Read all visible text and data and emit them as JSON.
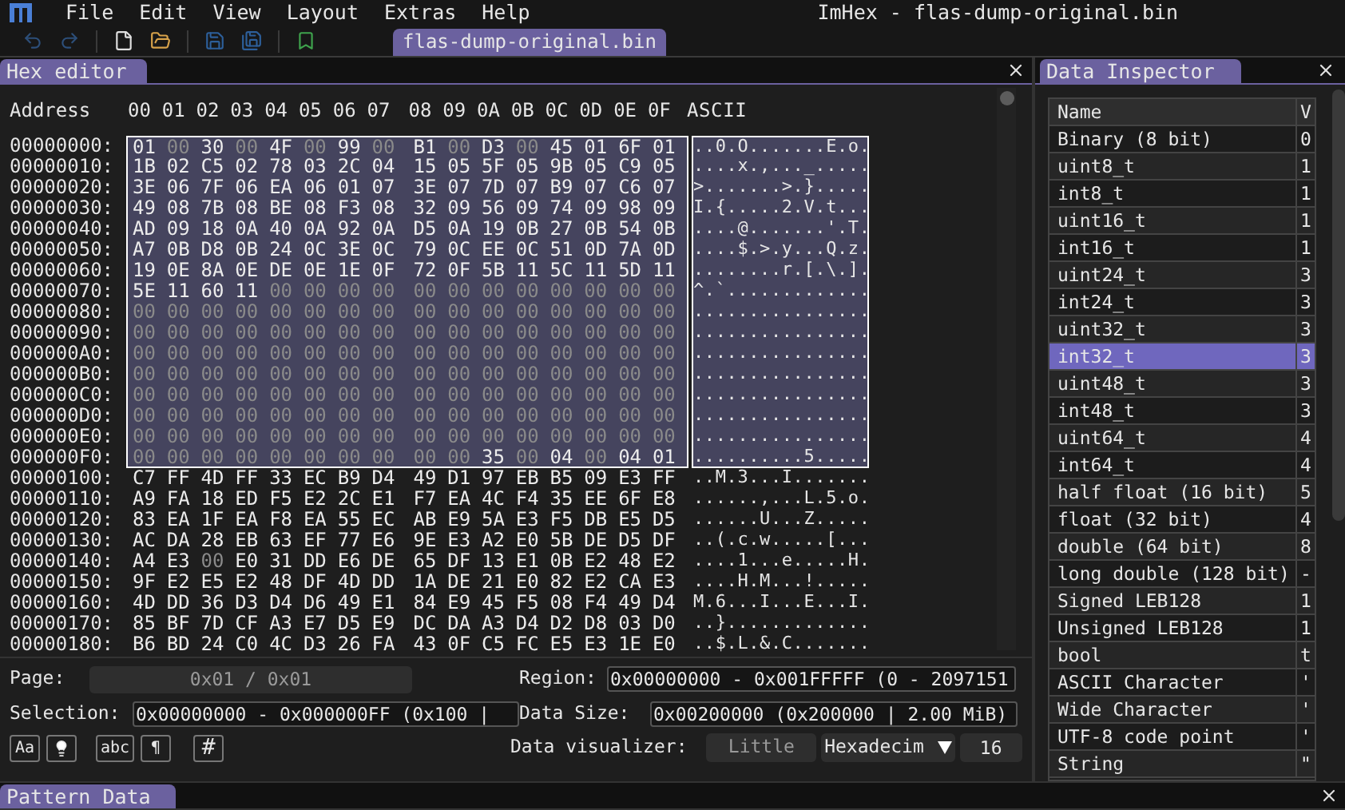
{
  "menu_bar": {
    "menus": [
      "File",
      "Edit",
      "View",
      "Layout",
      "Extras",
      "Help"
    ],
    "title": "ImHex - flas-dump-original.bin"
  },
  "file_tabs": [
    {
      "label": "flas-dump-original.bin",
      "selected": true
    }
  ],
  "hex_editor": {
    "title": "Hex editor",
    "address_header": "Address",
    "column_headers": [
      "00",
      "01",
      "02",
      "03",
      "04",
      "05",
      "06",
      "07",
      "08",
      "09",
      "0A",
      "0B",
      "0C",
      "0D",
      "0E",
      "0F"
    ],
    "ascii_header": "ASCII",
    "rows": [
      {
        "address": "00000000:",
        "bytes": "01 00 30 00 4F 00 99 00 B1 00 D3 00 45 01 6F 01",
        "ascii": "..0.O.......E.o.",
        "selected": true
      },
      {
        "address": "00000010:",
        "bytes": "1B 02 C5 02 78 03 2C 04 15 05 5F 05 9B 05 C9 05",
        "ascii": "....x.,..._.....",
        "selected": true
      },
      {
        "address": "00000020:",
        "bytes": "3E 06 7F 06 EA 06 01 07 3E 07 7D 07 B9 07 C6 07",
        "ascii": ">.......>.}.....",
        "selected": true
      },
      {
        "address": "00000030:",
        "bytes": "49 08 7B 08 BE 08 F3 08 32 09 56 09 74 09 98 09",
        "ascii": "I.{.....2.V.t...",
        "selected": true
      },
      {
        "address": "00000040:",
        "bytes": "AD 09 18 0A 40 0A 92 0A D5 0A 19 0B 27 0B 54 0B",
        "ascii": "....@.......'.T.",
        "selected": true
      },
      {
        "address": "00000050:",
        "bytes": "A7 0B D8 0B 24 0C 3E 0C 79 0C EE 0C 51 0D 7A 0D",
        "ascii": "....$.>.y...Q.z.",
        "selected": true
      },
      {
        "address": "00000060:",
        "bytes": "19 0E 8A 0E DE 0E 1E 0F 72 0F 5B 11 5C 11 5D 11",
        "ascii": "........r.[.\\.].",
        "selected": true
      },
      {
        "address": "00000070:",
        "bytes": "5E 11 60 11 00 00 00 00 00 00 00 00 00 00 00 00",
        "ascii": "^.`.............",
        "selected": true
      },
      {
        "address": "00000080:",
        "bytes": "00 00 00 00 00 00 00 00 00 00 00 00 00 00 00 00",
        "ascii": "................",
        "selected": true
      },
      {
        "address": "00000090:",
        "bytes": "00 00 00 00 00 00 00 00 00 00 00 00 00 00 00 00",
        "ascii": "................",
        "selected": true
      },
      {
        "address": "000000A0:",
        "bytes": "00 00 00 00 00 00 00 00 00 00 00 00 00 00 00 00",
        "ascii": "................",
        "selected": true
      },
      {
        "address": "000000B0:",
        "bytes": "00 00 00 00 00 00 00 00 00 00 00 00 00 00 00 00",
        "ascii": "................",
        "selected": true
      },
      {
        "address": "000000C0:",
        "bytes": "00 00 00 00 00 00 00 00 00 00 00 00 00 00 00 00",
        "ascii": "................",
        "selected": true
      },
      {
        "address": "000000D0:",
        "bytes": "00 00 00 00 00 00 00 00 00 00 00 00 00 00 00 00",
        "ascii": "................",
        "selected": true
      },
      {
        "address": "000000E0:",
        "bytes": "00 00 00 00 00 00 00 00 00 00 00 00 00 00 00 00",
        "ascii": "................",
        "selected": true
      },
      {
        "address": "000000F0:",
        "bytes": "00 00 00 00 00 00 00 00 00 00 35 00 04 00 04 01",
        "ascii": "..........5.....",
        "selected": true
      },
      {
        "address": "00000100:",
        "bytes": "C7 FF 4D FF 33 EC B9 D4 49 D1 97 EB B5 09 E3 FF",
        "ascii": "..M.3...I.......",
        "selected": false
      },
      {
        "address": "00000110:",
        "bytes": "A9 FA 18 ED F5 E2 2C E1 F7 EA 4C F4 35 EE 6F E8",
        "ascii": "......,...L.5.o.",
        "selected": false
      },
      {
        "address": "00000120:",
        "bytes": "83 EA 1F EA F8 EA 55 EC AB E9 5A E3 F5 DB E5 D5",
        "ascii": "......U...Z.....",
        "selected": false
      },
      {
        "address": "00000130:",
        "bytes": "AC DA 28 EB 63 EF 77 E6 9E E3 A2 E0 5B DE D5 DF",
        "ascii": "..(.c.w.....[...",
        "selected": false
      },
      {
        "address": "00000140:",
        "bytes": "A4 E3 00 E0 31 DD E6 DE 65 DF 13 E1 0B E2 48 E2",
        "ascii": "....1...e.....H.",
        "selected": false
      },
      {
        "address": "00000150:",
        "bytes": "9F E2 E5 E2 48 DF 4D DD 1A DE 21 E0 82 E2 CA E3",
        "ascii": "....H.M...!.....",
        "selected": false
      },
      {
        "address": "00000160:",
        "bytes": "4D DD 36 D3 D4 D6 49 E1 84 E9 45 F5 08 F4 49 D4",
        "ascii": "M.6...I...E...I.",
        "selected": false
      },
      {
        "address": "00000170:",
        "bytes": "85 BF 7D CF A3 E7 D5 E9 DC DA A3 D4 D2 D8 03 D0",
        "ascii": "..}.............",
        "selected": false
      },
      {
        "address": "00000180:",
        "bytes": "B6 BD 24 C0 4C D3 26 FA 43 0F C5 FC E5 E3 1E E0",
        "ascii": "..$.L.&.C.......",
        "selected": false
      }
    ],
    "page_label": "Page:",
    "page_value": "0x01 / 0x01",
    "region_label": "Region:",
    "region_value": "0x00000000 - 0x001FFFFF (0 - 2097151",
    "selection_label": "Selection:",
    "selection_value": "0x00000000 - 0x000000FF (0x100 |",
    "data_size_label": "Data Size:",
    "data_size_value": "0x00200000 (0x200000 | 2.00 MiB)",
    "tool_buttons": [
      {
        "kind": "text",
        "label": "Aa"
      },
      {
        "kind": "bulb"
      },
      {
        "kind": "text",
        "label": "abc"
      },
      {
        "kind": "text",
        "label": "¶"
      },
      {
        "kind": "text",
        "label": "#"
      }
    ],
    "visualizer_label": "Data visualizer:",
    "endian_button": "Little",
    "format_dropdown": "Hexadecim",
    "columns_value": "16"
  },
  "data_inspector": {
    "title": "Data Inspector",
    "columns": [
      "Name",
      "V"
    ],
    "rows": [
      {
        "name": "Binary (8 bit)",
        "value": "0",
        "selected": false
      },
      {
        "name": "uint8_t",
        "value": "1",
        "selected": false
      },
      {
        "name": "int8_t",
        "value": "1",
        "selected": false
      },
      {
        "name": "uint16_t",
        "value": "1",
        "selected": false
      },
      {
        "name": "int16_t",
        "value": "1",
        "selected": false
      },
      {
        "name": "uint24_t",
        "value": "3",
        "selected": false
      },
      {
        "name": "int24_t",
        "value": "3",
        "selected": false
      },
      {
        "name": "uint32_t",
        "value": "3",
        "selected": false
      },
      {
        "name": "int32_t",
        "value": "3",
        "selected": true
      },
      {
        "name": "uint48_t",
        "value": "3",
        "selected": false
      },
      {
        "name": "int48_t",
        "value": "3",
        "selected": false
      },
      {
        "name": "uint64_t",
        "value": "4",
        "selected": false
      },
      {
        "name": "int64_t",
        "value": "4",
        "selected": false
      },
      {
        "name": "half float (16 bit)",
        "value": "5",
        "selected": false
      },
      {
        "name": "float (32 bit)",
        "value": "4",
        "selected": false
      },
      {
        "name": "double (64 bit)",
        "value": "8",
        "selected": false
      },
      {
        "name": "long double (128 bit)",
        "value": "-",
        "selected": false
      },
      {
        "name": "Signed LEB128",
        "value": "1",
        "selected": false
      },
      {
        "name": "Unsigned LEB128",
        "value": "1",
        "selected": false
      },
      {
        "name": "bool",
        "value": "t",
        "selected": false
      },
      {
        "name": "ASCII Character",
        "value": "'",
        "selected": false
      },
      {
        "name": "Wide Character",
        "value": "'",
        "selected": false
      },
      {
        "name": "UTF-8 code point",
        "value": "'",
        "selected": false
      },
      {
        "name": "String",
        "value": "\"",
        "selected": false
      }
    ]
  },
  "pattern_data": {
    "title": "Pattern Data"
  }
}
